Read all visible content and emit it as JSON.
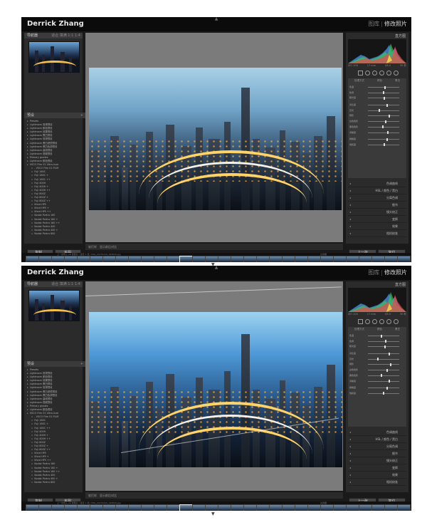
{
  "app": {
    "brand": "Derrick Zhang",
    "modules": [
      "图库",
      "修改照片"
    ],
    "active_module": "修改照片",
    "accent": "#e6e6e6",
    "panel_bg": "#2b2b2b"
  },
  "left_panel": {
    "navigator_title": "导航器",
    "navigator_opts": "适合  填满  1:1  1:4",
    "presets_title": "预设",
    "presets": [
      {
        "label": "Presets",
        "sub": false
      },
      {
        "label": "Lightroom 常规预设",
        "sub": false
      },
      {
        "label": "Lightroom 颜色预设",
        "sub": false
      },
      {
        "label": "Lightroom 效果预设",
        "sub": false
      },
      {
        "label": "Lightroom 黑白预设",
        "sub": false
      },
      {
        "label": "Lightroom 常规预设",
        "sub": false
      },
      {
        "label": "Lightroom 黑白滤镜预设",
        "sub": false
      },
      {
        "label": "Lightroom 黑白色调预设",
        "sub": false
      },
      {
        "label": "Lightroom 曲线预设",
        "sub": false
      },
      {
        "label": "Lightroom 视频预设",
        "sub": false
      },
      {
        "label": "Primary grades",
        "sub": false
      },
      {
        "label": "Lightroom 颜色预设",
        "sub": false
      },
      {
        "label": "VSCO Film 01 Ultra-luxe",
        "sub": false
      },
      {
        "label": "- VSCO Film 01 FILM",
        "sub": true
      },
      {
        "label": "Fuji 160C",
        "sub": true
      },
      {
        "label": "Fuji 160C +",
        "sub": true
      },
      {
        "label": "Fuji 160C ++",
        "sub": true
      },
      {
        "label": "Fuji 400H",
        "sub": true
      },
      {
        "label": "Fuji 400H +",
        "sub": true
      },
      {
        "label": "Fuji 400H ++",
        "sub": true
      },
      {
        "label": "Fuji 800Z",
        "sub": true
      },
      {
        "label": "Fuji 800Z +",
        "sub": true
      },
      {
        "label": "Fuji 800Z ++",
        "sub": true
      },
      {
        "label": "Ilford HP5",
        "sub": true
      },
      {
        "label": "Ilford HP5 +",
        "sub": true
      },
      {
        "label": "Ilford HP5 ++",
        "sub": true
      },
      {
        "label": "Kodak Portra 160",
        "sub": true
      },
      {
        "label": "Kodak Portra 160 +",
        "sub": true
      },
      {
        "label": "Kodak Portra 160 ++",
        "sub": true
      },
      {
        "label": "Kodak Portra 400",
        "sub": true
      },
      {
        "label": "Kodak Portra 400 +",
        "sub": true
      },
      {
        "label": "Kodak Portra 800",
        "sub": true
      }
    ],
    "copy_button": "复制...",
    "paste_button": "粘贴"
  },
  "toolbar": {
    "soft_proof": "软打样",
    "before_after": "显示前后对比"
  },
  "right_panel": {
    "histogram_title": "直方图",
    "hist_meta": [
      "ISO 100",
      "17 mm",
      "f/8.0",
      "30 秒"
    ],
    "basic_tabs": [
      "处理方式",
      "颜色",
      "黑白"
    ],
    "sliders_top": [
      {
        "label": "色温",
        "value": 0.52
      },
      {
        "label": "色调",
        "value": 0.48
      },
      {
        "label": "曝光度",
        "value": 0.5
      },
      {
        "label": "对比度",
        "value": 0.6
      },
      {
        "label": "高光",
        "value": 0.35
      },
      {
        "label": "阴影",
        "value": 0.65
      },
      {
        "label": "白色色阶",
        "value": 0.55
      },
      {
        "label": "黑色色阶",
        "value": 0.45
      },
      {
        "label": "清晰度",
        "value": 0.62
      },
      {
        "label": "鲜艳度",
        "value": 0.58
      },
      {
        "label": "饱和度",
        "value": 0.5
      }
    ],
    "sliders_bottom": [
      {
        "label": "色温",
        "value": 0.4
      },
      {
        "label": "色调",
        "value": 0.55
      },
      {
        "label": "曝光度",
        "value": 0.52
      },
      {
        "label": "对比度",
        "value": 0.65
      },
      {
        "label": "高光",
        "value": 0.3
      },
      {
        "label": "阴影",
        "value": 0.7
      },
      {
        "label": "白色色阶",
        "value": 0.6
      },
      {
        "label": "黑色色阶",
        "value": 0.4
      },
      {
        "label": "清晰度",
        "value": 0.66
      },
      {
        "label": "鲜艳度",
        "value": 0.6
      },
      {
        "label": "饱和度",
        "value": 0.48
      }
    ],
    "panels": [
      "色调曲线",
      "HSL / 颜色 / 黑白",
      "分离色调",
      "细节",
      "镜头校正",
      "变换",
      "效果",
      "相机校准"
    ],
    "prev_button": "上一张",
    "reset_button": "复位"
  },
  "filmstrip": {
    "label": "上一次导入  10 张照片 / 选定 1 张 / IMG_20170419_193629.jpg",
    "filter": "过滤器"
  }
}
